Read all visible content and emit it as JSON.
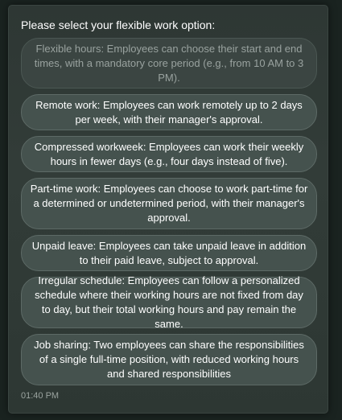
{
  "prompt": "Please select your flexible work option:",
  "options": [
    {
      "label": "Flexible hours: Employees can choose their start and end times, with a mandatory core period (e.g., from 10 AM to 3 PM).",
      "disabled": true
    },
    {
      "label": "Remote work: Employees can work remotely up to 2 days per week, with their manager's approval.",
      "disabled": false
    },
    {
      "label": "Compressed workweek: Employees can work their weekly hours in fewer days (e.g., four days instead of five).",
      "disabled": false
    },
    {
      "label": "Part-time work: Employees can choose to work part-time for a determined or undetermined period, with their manager's approval.",
      "disabled": false
    },
    {
      "label": "Unpaid leave: Employees can take unpaid leave in addition to their paid leave, subject to approval.",
      "disabled": false
    },
    {
      "label": "Irregular schedule: Employees can follow a personalized schedule where their working hours are not fixed from day to day, but their total working hours and pay remain the same.",
      "disabled": false
    },
    {
      "label": "Job sharing: Two employees can share the responsibilities of a single full-time position, with reduced working hours and shared responsibilities",
      "disabled": false
    }
  ],
  "timestamp": "01:40 PM"
}
